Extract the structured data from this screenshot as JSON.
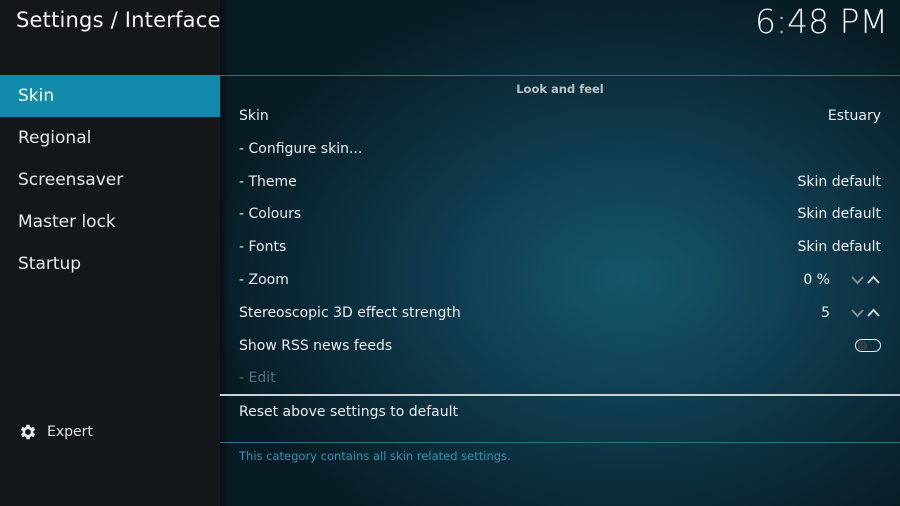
{
  "header": {
    "title": "Settings / Interface",
    "clock": "6:48 PM"
  },
  "sidebar": {
    "items": [
      {
        "label": "Skin",
        "active": true
      },
      {
        "label": "Regional",
        "active": false
      },
      {
        "label": "Screensaver",
        "active": false
      },
      {
        "label": "Master lock",
        "active": false
      },
      {
        "label": "Startup",
        "active": false
      }
    ],
    "expert_label": "Expert",
    "expert_icon": "gear-icon"
  },
  "main": {
    "section_title": "Look and feel",
    "rows": [
      {
        "label": "Skin",
        "value": "Estuary"
      },
      {
        "label": "- Configure skin...",
        "value": ""
      },
      {
        "label": "- Theme",
        "value": "Skin default"
      },
      {
        "label": "- Colours",
        "value": "Skin default"
      },
      {
        "label": "- Fonts",
        "value": "Skin default"
      },
      {
        "label": "- Zoom",
        "value": "0 %"
      },
      {
        "label": "Stereoscopic 3D effect strength",
        "value": "5"
      },
      {
        "label": "Show RSS news feeds",
        "value": "",
        "toggle_on": false
      },
      {
        "label": "- Edit",
        "value": "",
        "disabled": true
      }
    ],
    "reset_label": "Reset above settings to default",
    "help_text": "This category contains all skin related settings."
  },
  "colors": {
    "accent": "#128aab",
    "sidebar_bg": "#141719",
    "help_text": "#2f98b8"
  }
}
